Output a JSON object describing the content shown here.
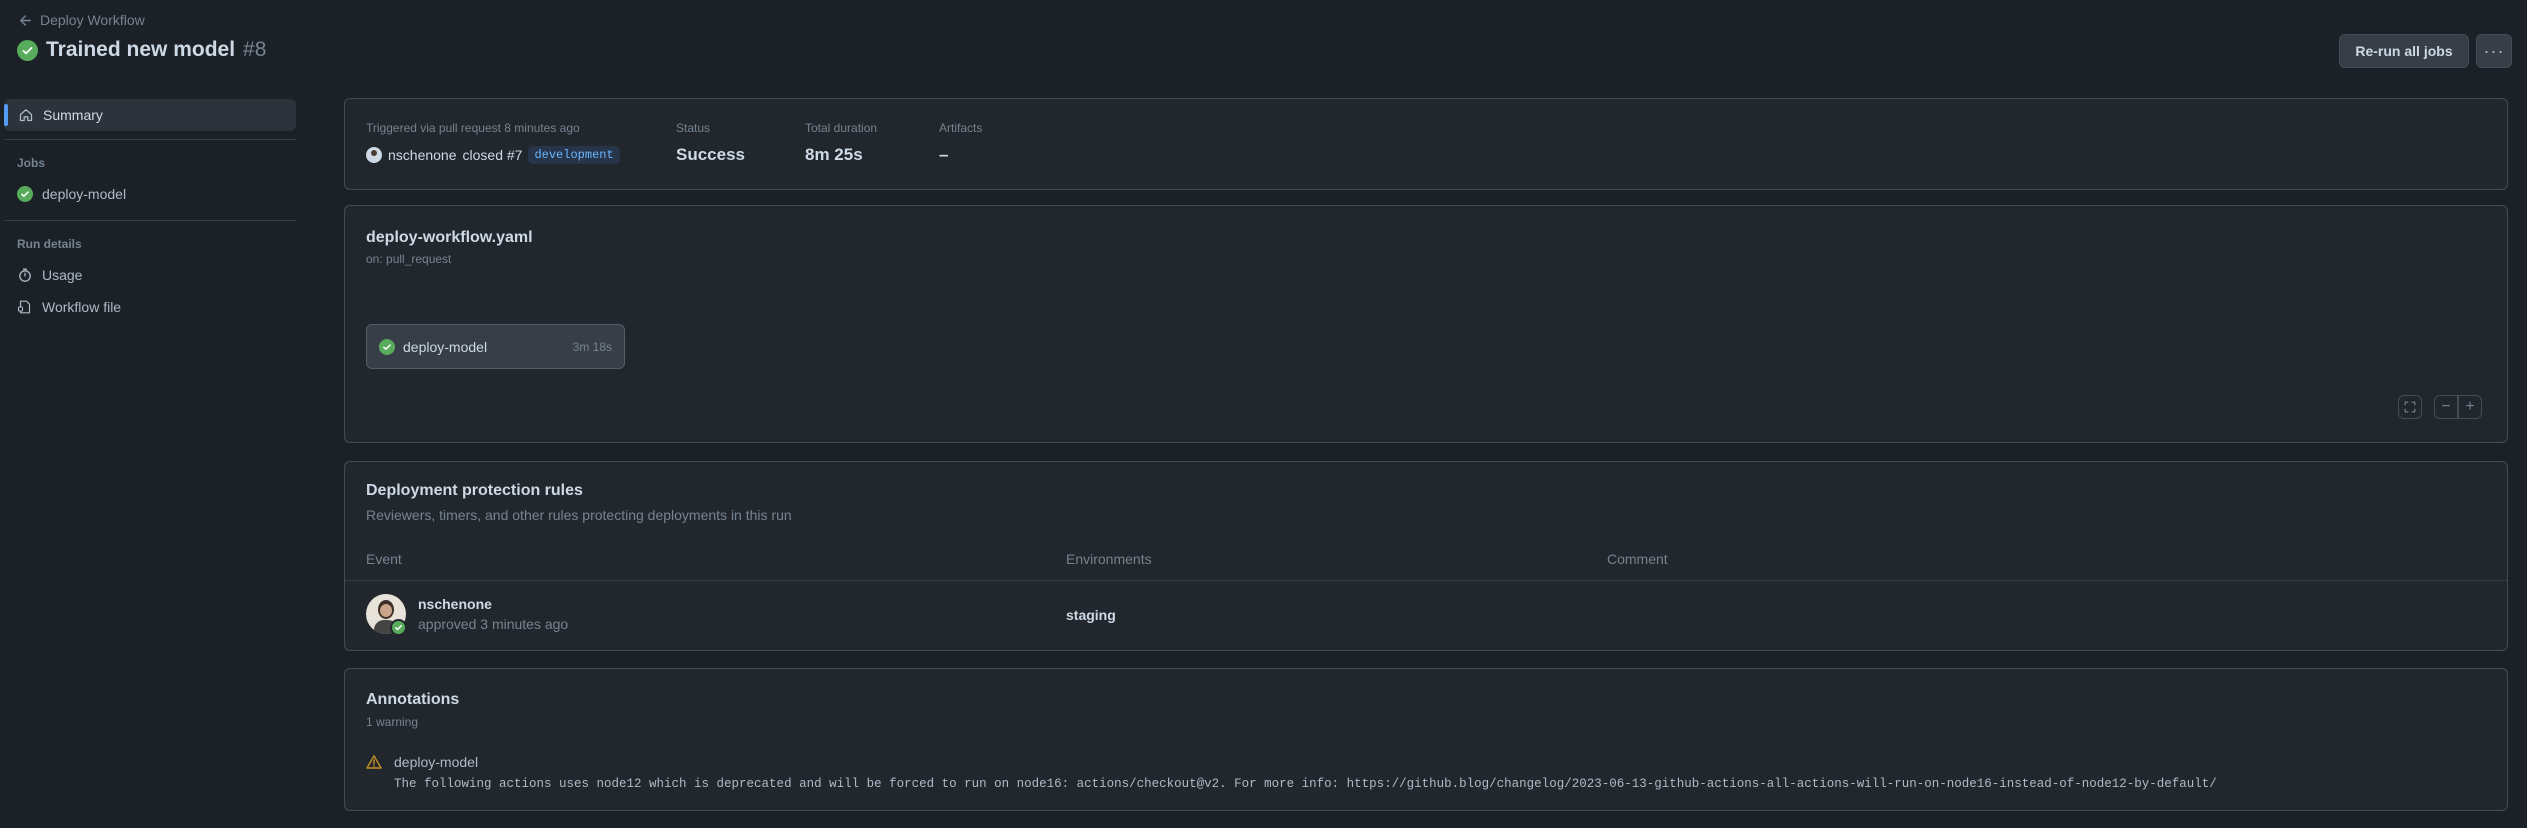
{
  "header": {
    "back_label": "Deploy Workflow",
    "title": "Trained new model",
    "run_number": "#8",
    "rerun_label": "Re-run all jobs",
    "more_label": "···"
  },
  "sidebar": {
    "summary_label": "Summary",
    "jobs_heading": "Jobs",
    "jobs": [
      {
        "label": "deploy-model"
      }
    ],
    "run_details_heading": "Run details",
    "run_details": [
      {
        "label": "Usage"
      },
      {
        "label": "Workflow file"
      }
    ]
  },
  "summary": {
    "trigger_label": "Triggered via pull request 8 minutes ago",
    "actor": "nschenone",
    "action": "closed #7",
    "branch": "development",
    "status_label": "Status",
    "status_value": "Success",
    "duration_label": "Total duration",
    "duration_value": "8m 25s",
    "artifacts_label": "Artifacts",
    "artifacts_value": "–"
  },
  "workflow": {
    "file": "deploy-workflow.yaml",
    "trigger": "on: pull_request",
    "job": {
      "name": "deploy-model",
      "duration": "3m 18s"
    },
    "zoom_minus": "−",
    "zoom_plus": "+"
  },
  "protection": {
    "title": "Deployment protection rules",
    "subtitle": "Reviewers, timers, and other rules protecting deployments in this run",
    "columns": [
      "Event",
      "Environments",
      "Comment"
    ],
    "rows": [
      {
        "user": "nschenone",
        "event": "approved 3 minutes ago",
        "environment": "staging",
        "comment": ""
      }
    ]
  },
  "annotations": {
    "title": "Annotations",
    "count": "1 warning",
    "items": [
      {
        "job": "deploy-model",
        "message": "The following actions uses node12 which is deprecated and will be forced to run on node16: actions/checkout@v2. For more info: https://github.blog/changelog/2023-06-13-github-actions-all-actions-will-run-on-node16-instead-of-node12-by-default/"
      }
    ]
  },
  "colors": {
    "background": "#1c2128",
    "panel": "#22272e",
    "success": "#57ab5a",
    "accent": "#539bf5",
    "warning": "#c69026"
  }
}
